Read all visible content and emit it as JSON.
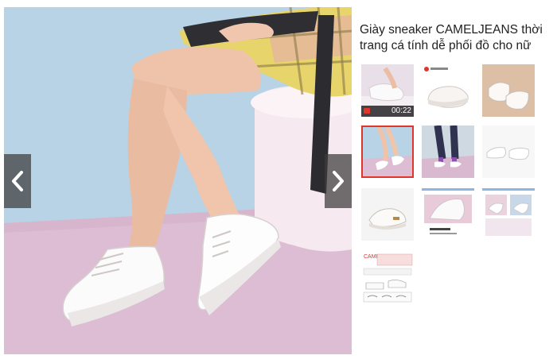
{
  "product": {
    "title": "Giày sneaker CAMELJEANS thời trang cá tính dễ phối đồ cho nữ"
  },
  "viewer": {
    "prev_icon": "chevron-left-icon",
    "next_icon": "chevron-right-icon",
    "current_index": 4
  },
  "thumbnails": [
    {
      "kind": "video",
      "duration": "00:22"
    },
    {
      "kind": "image",
      "brand_text": "CAMEL@camel"
    },
    {
      "kind": "image"
    },
    {
      "kind": "image",
      "selected": true
    },
    {
      "kind": "image"
    },
    {
      "kind": "image"
    },
    {
      "kind": "image"
    },
    {
      "kind": "image"
    },
    {
      "kind": "image"
    },
    {
      "kind": "image",
      "brand_text": "CAMEL"
    }
  ],
  "colors": {
    "selected_border": "#e0352b",
    "nav_button_bg": "#3c3c3c",
    "wall_blue": "#b9d3e6",
    "floor_pink": "#dcbcd2"
  }
}
